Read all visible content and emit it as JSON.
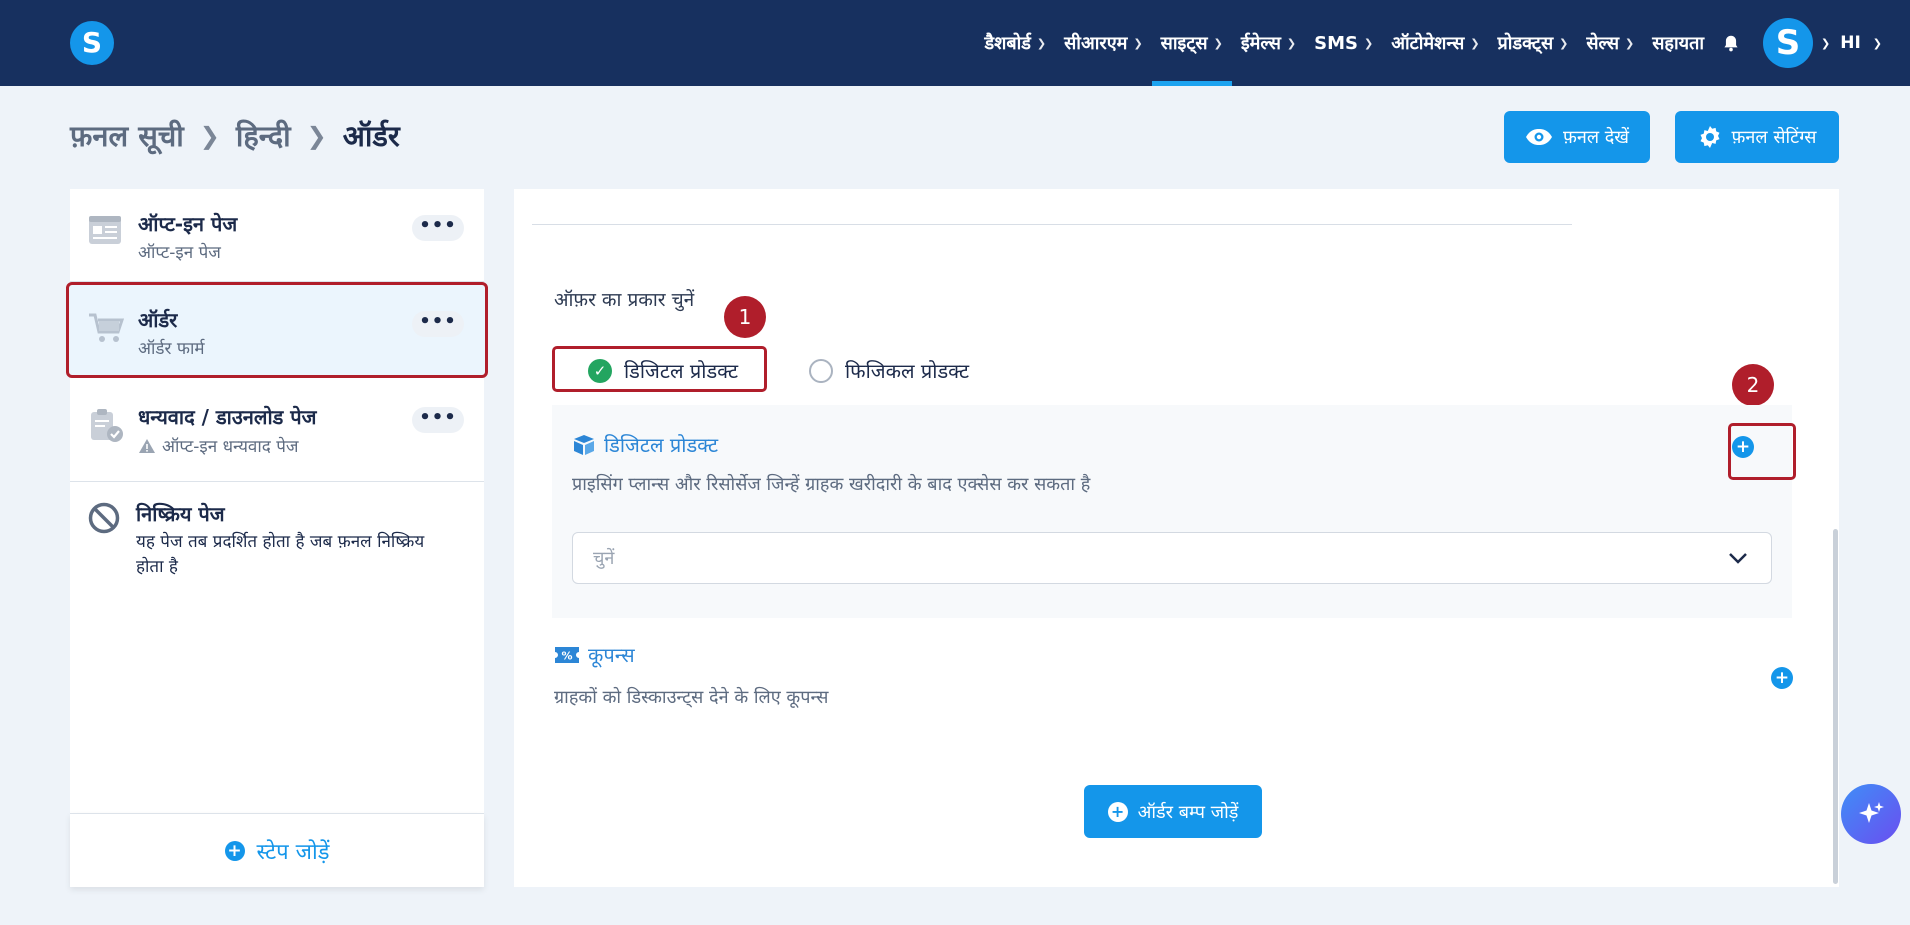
{
  "nav": {
    "logo": "S",
    "items": [
      {
        "label": "डैशबोर्ड",
        "chevron": true,
        "active": false
      },
      {
        "label": "सीआरएम",
        "chevron": true,
        "active": false
      },
      {
        "label": "साइट्स",
        "chevron": true,
        "active": true
      },
      {
        "label": "ईमेल्स",
        "chevron": true,
        "active": false
      },
      {
        "label": "SMS",
        "chevron": true,
        "active": false
      },
      {
        "label": "ऑटोमेशन्स",
        "chevron": true,
        "active": false
      },
      {
        "label": "प्रोडक्ट्स",
        "chevron": true,
        "active": false
      },
      {
        "label": "सेल्स",
        "chevron": true,
        "active": false
      },
      {
        "label": "सहायता",
        "chevron": false,
        "active": false
      }
    ],
    "avatar": "S",
    "language": "HI",
    "accent_color": "#1ca3f0",
    "bar_color": "#17305f"
  },
  "breadcrumb": {
    "items": [
      "फ़नल सूची",
      "हिन्दी",
      "ऑर्डर"
    ]
  },
  "header_buttons": {
    "view_funnel": "फ़नल देखें",
    "funnel_settings": "फ़नल सेटिंग्स"
  },
  "sidebar": {
    "steps": [
      {
        "title": "ऑप्ट-इन पेज",
        "subtitle": "ऑप्ट-इन पेज",
        "icon": "page-layout-icon",
        "menu": "•••"
      },
      {
        "title": "ऑर्डर",
        "subtitle": "ऑर्डर फार्म",
        "icon": "cart-icon",
        "menu": "•••",
        "selected": true
      },
      {
        "title": "धन्यवाद / डाउनलोड पेज",
        "subtitle": "ऑप्ट-इन धन्यवाद पेज",
        "icon": "clipboard-check-icon",
        "menu": "•••",
        "warning": true
      }
    ],
    "inactive": {
      "title": "निष्क्रिय पेज",
      "desc_line1": "यह पेज तब प्रदर्शित होता है जब फ़नल निष्क्रिय",
      "desc_line2": "होता है"
    },
    "add_step": "स्टेप जोड़ें"
  },
  "main": {
    "offer_type_label": "ऑफ़र का प्रकार चुनें",
    "options": {
      "digital": "डिजिटल प्रोडक्ट",
      "physical": "फिजिकल प्रोडक्ट",
      "selected": "digital"
    },
    "annotations": {
      "first": "1",
      "second": "2"
    },
    "digital_section": {
      "title": "डिजिटल प्रोडक्ट",
      "desc": "प्राइसिंग प्लान्स और रिसोर्सेज जिन्हें ग्राहक खरीदारी के बाद एक्सेस कर सकता है",
      "select_placeholder": "चुनें"
    },
    "coupons": {
      "title": "कूपन्स",
      "desc": "ग्राहकों को डिस्काउन्ट्स देने के लिए कूपन्स"
    },
    "order_bump_button": "ऑर्डर बम्प जोड़ें"
  }
}
